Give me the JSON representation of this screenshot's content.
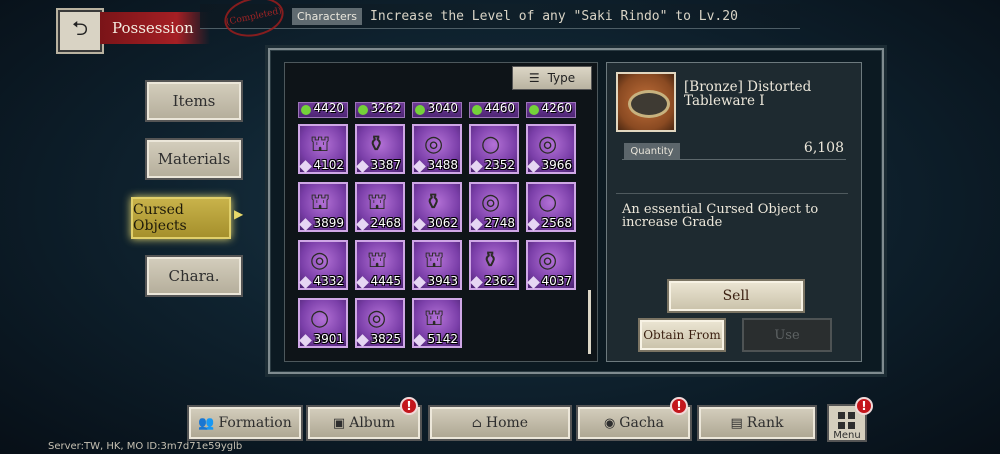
{
  "header": {
    "title": "Possession",
    "stamp": "(Completed)",
    "mission_tag": "Characters",
    "mission_text": "Increase the Level of any \"Saki Rindo\" to Lv.20"
  },
  "categories": [
    {
      "label": "Items"
    },
    {
      "label": "Materials"
    },
    {
      "label": "Cursed Objects"
    },
    {
      "label": "Chara."
    }
  ],
  "grid": {
    "type_label": "Type",
    "partial_counts": [
      "4420",
      "3262",
      "3040",
      "4460",
      "4260"
    ],
    "items": [
      {
        "count": "4102",
        "icon": "lantern-icon"
      },
      {
        "count": "3387",
        "icon": "bottle-icon"
      },
      {
        "count": "3488",
        "icon": "ring-icon"
      },
      {
        "count": "2352",
        "icon": "necklace-icon"
      },
      {
        "count": "3966",
        "icon": "ring-icon"
      },
      {
        "count": "3899",
        "icon": "lantern-icon"
      },
      {
        "count": "2468",
        "icon": "lantern-icon"
      },
      {
        "count": "3062",
        "icon": "bottle-icon"
      },
      {
        "count": "2748",
        "icon": "ring-icon"
      },
      {
        "count": "2568",
        "icon": "necklace-icon"
      },
      {
        "count": "4332",
        "icon": "ring-icon"
      },
      {
        "count": "4445",
        "icon": "lantern-icon"
      },
      {
        "count": "3943",
        "icon": "lantern-icon"
      },
      {
        "count": "2362",
        "icon": "bottle-icon"
      },
      {
        "count": "4037",
        "icon": "ring-icon"
      },
      {
        "count": "3901",
        "icon": "necklace-icon"
      },
      {
        "count": "3825",
        "icon": "ring-icon"
      },
      {
        "count": "5142",
        "icon": "lantern-icon"
      }
    ]
  },
  "detail": {
    "name": "[Bronze] Distorted Tableware I",
    "quantity_label": "Quantity",
    "quantity_value": "6,108",
    "description": "An essential Cursed Object to increase Grade",
    "sell_label": "Sell",
    "obtain_label": "Obtain From",
    "use_label": "Use"
  },
  "nav": [
    {
      "label": "Formation",
      "icon": "people-icon",
      "badge": ""
    },
    {
      "label": "Album",
      "icon": "album-icon",
      "badge": "!"
    },
    {
      "label": "Home",
      "icon": "home-icon",
      "badge": ""
    },
    {
      "label": "Gacha",
      "icon": "gacha-icon",
      "badge": "!"
    },
    {
      "label": "Rank",
      "icon": "rank-icon",
      "badge": ""
    }
  ],
  "menu": {
    "label": "Menu",
    "badge": "!"
  },
  "server_info": "Server:TW, HK, MO ID:3m7d71e59yglb",
  "colors": {
    "accent_red": "#a51f24",
    "item_purple": "#7b3fa9",
    "active_tab": "#c8b24a"
  }
}
